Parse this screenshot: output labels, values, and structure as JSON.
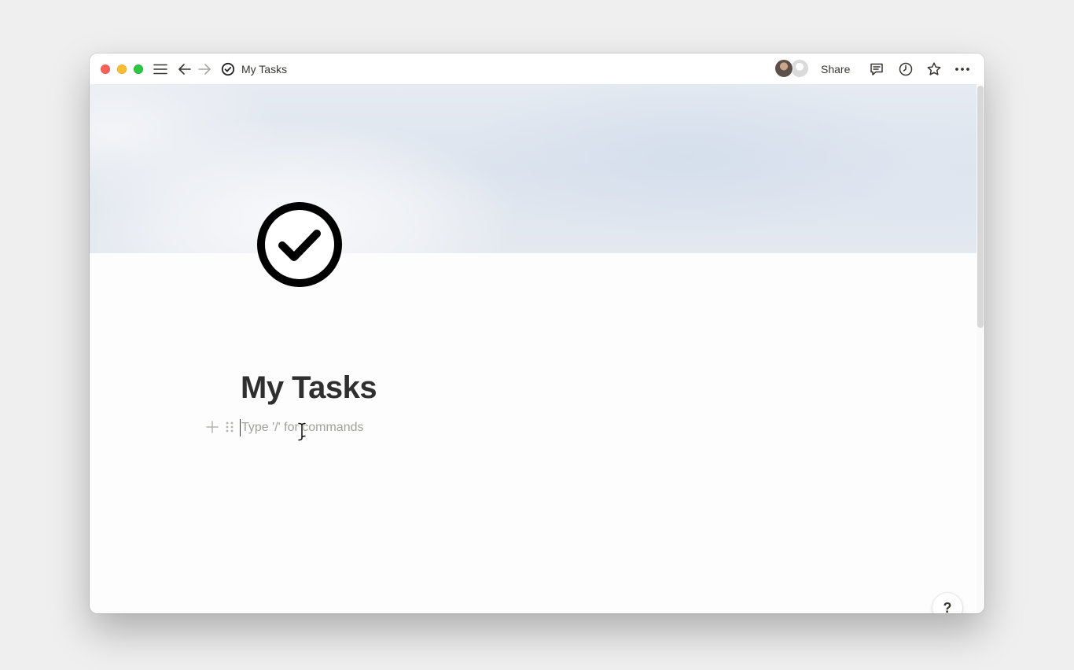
{
  "titlebar": {
    "page_title": "My Tasks",
    "share_label": "Share",
    "icons": {
      "close": "close-window",
      "minimize": "minimize-window",
      "maximize": "maximize-window",
      "menu": "hamburger-menu-icon",
      "back": "arrow-left-icon",
      "forward": "arrow-right-icon",
      "page": "check-circle-icon",
      "comments": "comment-icon",
      "history": "clock-icon",
      "favorite": "star-icon",
      "more": "ellipsis-icon"
    }
  },
  "page": {
    "title": "My Tasks",
    "icon": "check-circle-icon",
    "block_placeholder": "Type '/' for commands"
  },
  "help": {
    "label": "?"
  },
  "colors": {
    "text": "#37352f",
    "placeholder": "#a09f9c",
    "close": "#ff5f57",
    "minimize": "#febc2e",
    "maximize": "#28c840"
  }
}
